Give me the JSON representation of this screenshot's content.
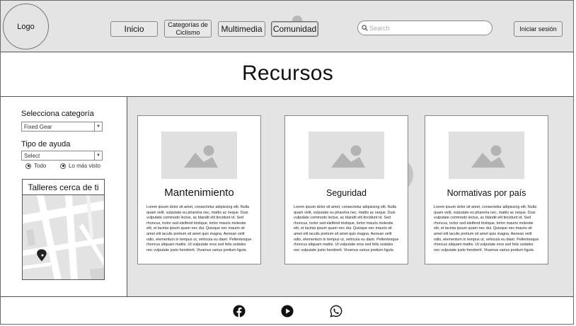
{
  "header": {
    "logo": "Logo",
    "nav": {
      "inicio": "Inicio",
      "categorias_line1": "Categorías de",
      "categorias_line2": "Ciclismo",
      "multimedia": "Multimedia",
      "comunidad": "Comunidad"
    },
    "search": {
      "placeholder": "Search",
      "icon": "search-icon"
    },
    "login_label": "Iniciar sesión"
  },
  "page": {
    "title": "Recursos"
  },
  "sidebar": {
    "category_label": "Selecciona categoría",
    "category_value": "Fixed Gear",
    "help_label": "Tipo de ayuda",
    "help_value": "Select",
    "radio_all": "Todo",
    "radio_viewed": "Lo más visto",
    "map_title": "Talleres cerca de ti",
    "map_icon": "map-pin-icon"
  },
  "cards": [
    {
      "title": "Mantenimiento",
      "icon": "image-placeholder-icon",
      "body": "Lorem ipsum dolor sit amet, consectetur adipiscing elit. Nulla quam velit, vulputate eu pharetra nec, mattis ac neque. Duis vulputate commodo lectus, ac blandit elit tincidunt id. Sed rhoncus, tortor sed eleifend tristique, tortor mauris molestie elit, et lacinia ipsum quam nec dui. Quisque nec mauris sit amet elit iaculis pretium sit amet quis magna. Aenean velit odio, elementum in tempus ut, vehicula eu diam. Pellentesque rhoncus aliquam mattis. Ut vulputate eros sed felis sodales nec vulputate justo hendrerit. Vivamus varius pretium ligula"
    },
    {
      "title": "Seguridad",
      "icon": "image-placeholder-icon",
      "body": "Lorem ipsum dolor sit amet, consectetur adipiscing elit. Nulla quam velit, vulputate eu pharetra nec, mattis ac neque. Duis vulputate commodo lectus, ac blandit elit tincidunt id. Sed rhoncus, tortor sed eleifend tristique, tortor mauris molestie elit, et lacinia ipsum quam nec dui. Quisque nec mauris sit amet elit iaculis pretium sit amet quis magna. Aenean velit odio, elementum in tempus ut, vehicula eu diam. Pellentesque rhoncus aliquam mattis. Ut vulputate eros sed felis sodales nec vulputate justo hendrerit. Vivamus varius pretium ligula"
    },
    {
      "title": "Normativas por país",
      "icon": "image-placeholder-icon",
      "body": "Lorem ipsum dolor sit amet, consectetur adipiscing elit. Nulla quam velit, vulputate eu pharetra nec, mattis ac neque. Duis vulputate commodo lectus, ac blandit elit tincidunt id. Sed rhoncus, tortor sed eleifend tristique, tortor mauris molestie elit, et lacinia ipsum quam nec dui. Quisque nec mauris sit amet elit iaculis pretium sit amet quis magna. Aenean velit odio, elementum in tempus ut, vehicula eu diam. Pellentesque rhoncus aliquam mattis. Ut vulputate eros sed felis sodales nec vulputate justo hendrerit. Vivamus varius pretium ligula"
    }
  ],
  "footer": {
    "icons": [
      "facebook-icon",
      "youtube-icon",
      "whatsapp-icon"
    ]
  },
  "colors": {
    "panel_grey": "#e4e4e4",
    "border": "#555555",
    "placeholder": "#b3b3b3",
    "icon_dark": "#111111"
  }
}
